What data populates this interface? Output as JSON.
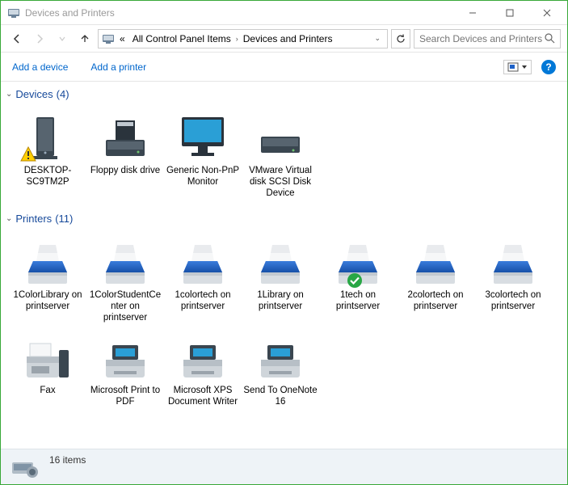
{
  "window": {
    "title": "Devices and Printers"
  },
  "breadcrumb": {
    "ellipsis": "«",
    "items": [
      "All Control Panel Items",
      "Devices and Printers"
    ]
  },
  "search": {
    "placeholder": "Search Devices and Printers"
  },
  "commands": {
    "add_device": "Add a device",
    "add_printer": "Add a printer"
  },
  "groups": [
    {
      "name": "Devices",
      "count": "(4)",
      "items": [
        {
          "label": "DESKTOP-SC9TM2P",
          "icon": "pc",
          "warn": true
        },
        {
          "label": "Floppy disk drive",
          "icon": "floppy"
        },
        {
          "label": "Generic Non-PnP Monitor",
          "icon": "monitor"
        },
        {
          "label": "VMware Virtual disk SCSI Disk Device",
          "icon": "hdd"
        }
      ]
    },
    {
      "name": "Printers",
      "count": "(11)",
      "items": [
        {
          "label": "1ColorLibrary on printserver",
          "icon": "printer"
        },
        {
          "label": "1ColorStudentCenter on printserver",
          "icon": "printer"
        },
        {
          "label": "1colortech on printserver",
          "icon": "printer"
        },
        {
          "label": "1Library on printserver",
          "icon": "printer"
        },
        {
          "label": "1tech on printserver",
          "icon": "printer",
          "default": true
        },
        {
          "label": "2colortech on printserver",
          "icon": "printer"
        },
        {
          "label": "3colortech on printserver",
          "icon": "printer"
        },
        {
          "label": "Fax",
          "icon": "fax"
        },
        {
          "label": "Microsoft Print to PDF",
          "icon": "bwprinter"
        },
        {
          "label": "Microsoft XPS Document Writer",
          "icon": "bwprinter"
        },
        {
          "label": "Send To OneNote 16",
          "icon": "bwprinter"
        }
      ]
    }
  ],
  "status": {
    "text": "16 items"
  }
}
